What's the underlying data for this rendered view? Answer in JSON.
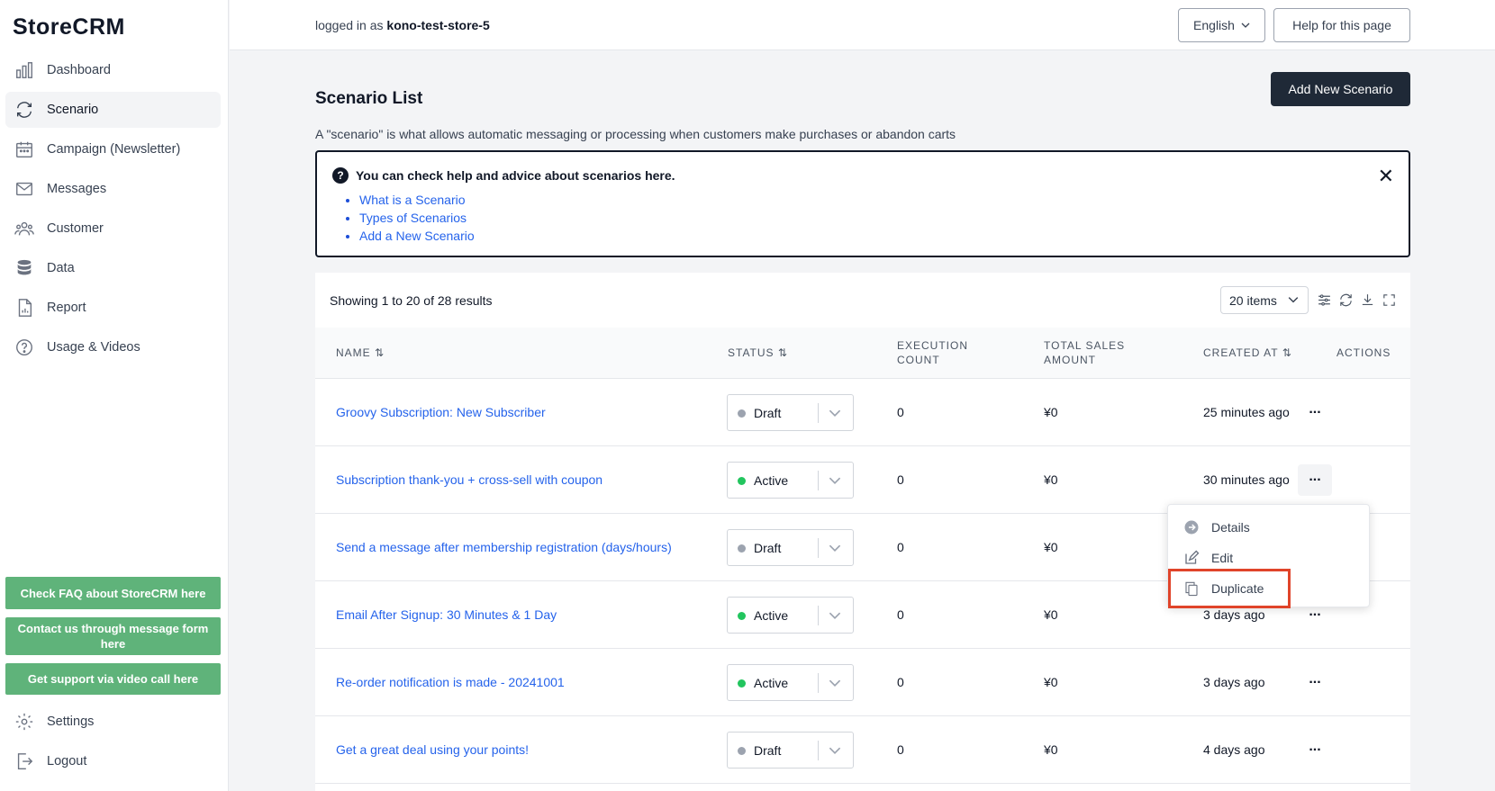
{
  "app": {
    "name": "StoreCRM"
  },
  "sidebar": {
    "items": [
      {
        "label": "Dashboard",
        "icon": "chart-bar-icon"
      },
      {
        "label": "Scenario",
        "icon": "refresh-icon",
        "active": true
      },
      {
        "label": "Campaign (Newsletter)",
        "icon": "calendar-icon"
      },
      {
        "label": "Messages",
        "icon": "envelope-icon"
      },
      {
        "label": "Customer",
        "icon": "users-icon"
      },
      {
        "label": "Data",
        "icon": "database-icon"
      },
      {
        "label": "Report",
        "icon": "document-chart-icon"
      },
      {
        "label": "Usage & Videos",
        "icon": "question-circle-icon"
      }
    ],
    "support": {
      "faq": "Check FAQ about StoreCRM here",
      "contact": "Contact us through message form here",
      "video": "Get support via video call here"
    },
    "bottom": [
      {
        "label": "Settings",
        "icon": "gear-icon"
      },
      {
        "label": "Logout",
        "icon": "logout-icon"
      }
    ]
  },
  "header": {
    "logged_prefix": "logged in as",
    "store": "kono-test-store-5",
    "language": "English",
    "help": "Help for this page"
  },
  "main": {
    "title": "Scenario List",
    "add_button": "Add New Scenario",
    "description": "A \"scenario\" is what allows automatic messaging or processing when customers make purchases or abandon carts",
    "help_box": {
      "heading": "You can check help and advice about scenarios here.",
      "links": [
        "What is a Scenario",
        "Types of Scenarios",
        "Add a New Scenario"
      ]
    }
  },
  "table": {
    "showing": "Showing 1 to 20 of 28 results",
    "page_size": "20 items",
    "headers": {
      "name": "NAME",
      "status": "STATUS",
      "execution_count_1": "EXECUTION",
      "execution_count_2": "COUNT",
      "total_sales_1": "TOTAL SALES",
      "total_sales_2": "AMOUNT",
      "created_at": "CREATED AT",
      "actions": "ACTIONS"
    },
    "rows": [
      {
        "name": "Groovy Subscription: New Subscriber",
        "status": "Draft",
        "count": "0",
        "sales": "¥0",
        "created": "25 minutes ago"
      },
      {
        "name": "Subscription thank-you + cross-sell with coupon",
        "status": "Active",
        "count": "0",
        "sales": "¥0",
        "created": "30 minutes ago"
      },
      {
        "name": "Send a message after membership registration (days/hours)",
        "status": "Draft",
        "count": "0",
        "sales": "¥0",
        "created": ""
      },
      {
        "name": "Email After Signup: 30 Minutes & 1 Day",
        "status": "Active",
        "count": "0",
        "sales": "¥0",
        "created": "3 days ago"
      },
      {
        "name": "Re-order notification is made - 20241001",
        "status": "Active",
        "count": "0",
        "sales": "¥0",
        "created": "3 days ago"
      },
      {
        "name": "Get a great deal using your points!",
        "status": "Draft",
        "count": "0",
        "sales": "¥0",
        "created": "4 days ago"
      }
    ],
    "actions_label": "...",
    "menu": {
      "details": "Details",
      "edit": "Edit",
      "duplicate": "Duplicate"
    }
  },
  "colors": {
    "active": "#22c55e",
    "draft": "#9ca3af",
    "link": "#2563eb",
    "support": "#5fb37a",
    "highlight": "#e0442a"
  }
}
